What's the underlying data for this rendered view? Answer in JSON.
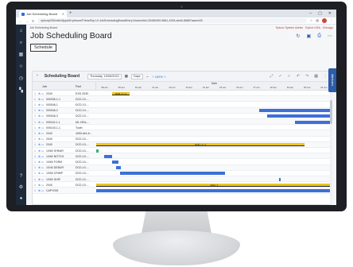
{
  "browser": {
    "tab_title": "Job Scheduling Board",
    "new_tab": "+",
    "url": "epicorp2/Kinetic/Apps/ErpHome/Prime/Erp.UI.JobSchedulingBoardEntry?channelId=2549b300-9681-4304-aee6-86867aaeec05"
  },
  "breadcrumb": {
    "current": "Job Scheduling Board",
    "right_items": [
      "Epicor System Admin",
      "Epicor USA - Chicago"
    ]
  },
  "page": {
    "title": "Job Scheduling Board",
    "schedule_label": "Schedule"
  },
  "toolbar": {
    "title": "Scheduling Board",
    "date": "Thursday, 10/06/2022",
    "view": "Days",
    "zoom": "+ 100% +"
  },
  "grid": {
    "job_header": "Job",
    "part_header": "Part",
    "day_label": "6am",
    "hours": [
      "08 am",
      "09 am",
      "10 am",
      "11 am",
      "12 am",
      "13 am",
      "14 am",
      "15 am",
      "16 am",
      "17 am",
      "18 am",
      "19 am",
      "20 am",
      "21 am"
    ],
    "rows": [
      {
        "job": "2040",
        "part": "EXD-2030"
      },
      {
        "job": "000036-1-1",
        "part": "DCD-10-..."
      },
      {
        "job": "000046-1",
        "part": "DCD-10-..."
      },
      {
        "job": "000046-2",
        "part": "DCD-10-..."
      },
      {
        "job": "000046-3",
        "part": "DCD-10-..."
      },
      {
        "job": "000116-1-1",
        "part": "ML-HEA-..."
      },
      {
        "job": "000140-1-1",
        "part": "Tooth"
      },
      {
        "job": "2040",
        "part": "4050-AIA-6..."
      },
      {
        "job": "2040",
        "part": "DCD-10-..."
      },
      {
        "job": "2040",
        "part": "DCD-10-..."
      },
      {
        "job": "10/60 SHEAR",
        "part": "DCD-10-..."
      },
      {
        "job": "10/60 NOTCH",
        "part": "DCD-10-..."
      },
      {
        "job": "10/60 FORM",
        "part": "DCD-10-..."
      },
      {
        "job": "10/40 DEBUR",
        "part": "DCD-10-..."
      },
      {
        "job": "10/50 CRIMP",
        "part": "DCD-10-..."
      },
      {
        "job": "10/60 SHIP",
        "part": "DCD-10-..."
      },
      {
        "job": "2040",
        "part": "DCD-10-..."
      },
      {
        "job": "CAPY000",
        "part": ""
      }
    ]
  },
  "bar_labels": [
    "2040 / 1 / 1",
    "2040 / 1 / 1",
    "2040 / 1"
  ],
  "side_tab": "Attributes",
  "colors": {
    "primary": "#2d5ca8",
    "accent_blue": "#3d6fd8",
    "gold": "#f0c419",
    "dark_bar": "#1e2a3a",
    "green": "#3cb371"
  }
}
